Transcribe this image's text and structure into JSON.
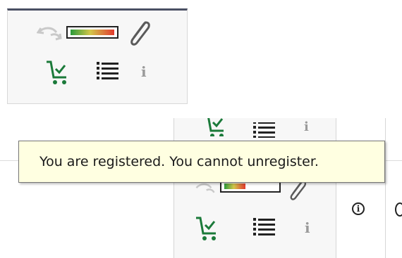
{
  "tooltip": {
    "text": "You are registered. You cannot unregister."
  },
  "colors": {
    "cart": "#1b7a3a",
    "header_bar": "#4a4f63",
    "tooltip_bg": "#ffffe1"
  },
  "icons": {
    "undo": "undo-arrow-icon",
    "bar": "rating-bar-icon",
    "paperclip": "paperclip-icon",
    "cart": "cart-check-icon",
    "list": "list-icon",
    "info": "info-letter-icon",
    "info_circle": "info-circle-icon"
  },
  "labels": {
    "info_letter": "i",
    "info_circle": "i"
  }
}
